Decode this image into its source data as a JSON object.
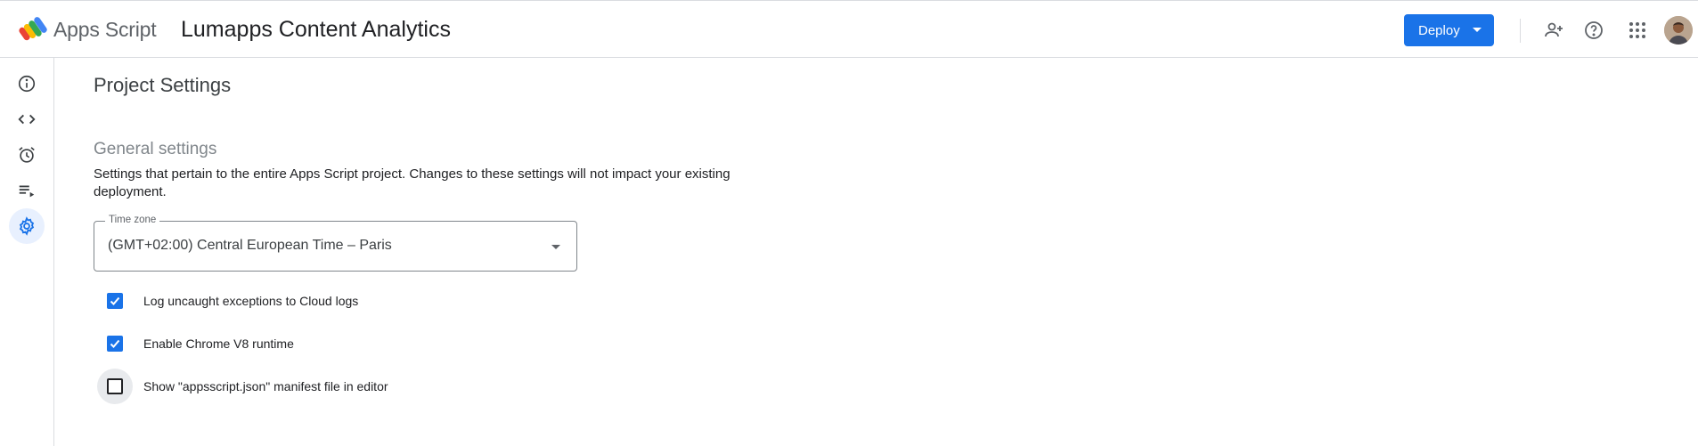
{
  "header": {
    "product_name": "Apps Script",
    "project_title": "Lumapps Content Analytics",
    "deploy_label": "Deploy",
    "icons": [
      "add-person-icon",
      "help-icon",
      "apps-grid-icon"
    ]
  },
  "sidebar": {
    "items": [
      {
        "name": "overview",
        "icon": "info-icon",
        "active": false
      },
      {
        "name": "editor",
        "icon": "code-icon",
        "active": false
      },
      {
        "name": "triggers",
        "icon": "alarm-icon",
        "active": false
      },
      {
        "name": "executions",
        "icon": "executions-icon",
        "active": false
      },
      {
        "name": "project-settings",
        "icon": "gear-icon",
        "active": true
      }
    ]
  },
  "main": {
    "page_title": "Project Settings",
    "section_title": "General settings",
    "section_description": "Settings that pertain to the entire Apps Script project. Changes to these settings will not impact your existing deployment.",
    "timezone": {
      "label": "Time zone",
      "value": "(GMT+02:00) Central European Time – Paris"
    },
    "checkboxes": [
      {
        "label": "Log uncaught exceptions to Cloud logs",
        "checked": true
      },
      {
        "label": "Enable Chrome V8 runtime",
        "checked": true
      },
      {
        "label": "Show \"appsscript.json\" manifest file in editor",
        "checked": false
      }
    ]
  },
  "colors": {
    "accent": "#1a73e8",
    "active_nav_bg": "#e8f0fe",
    "border": "#dadce0",
    "muted_text": "#80868b"
  }
}
